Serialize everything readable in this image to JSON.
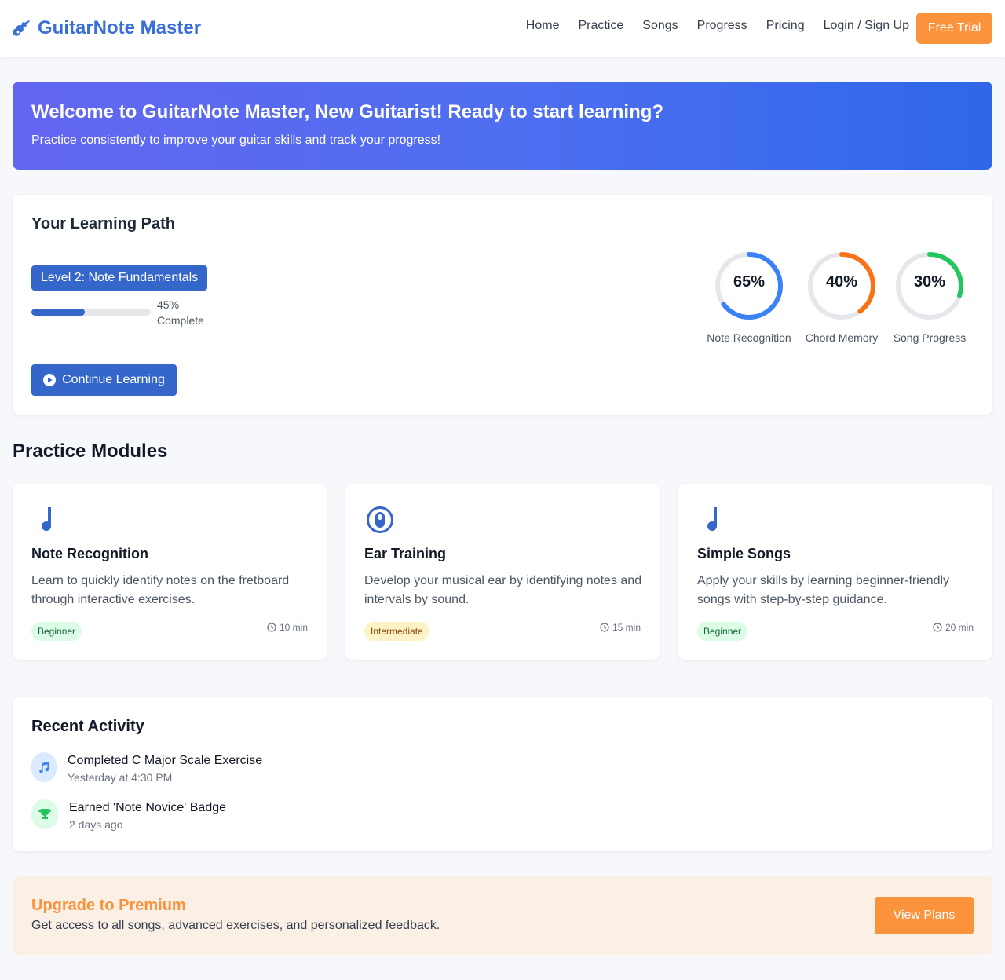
{
  "header": {
    "logo_text": "GuitarNote Master",
    "nav": [
      "Home",
      "Practice",
      "Songs",
      "Progress",
      "Pricing",
      "Login / Sign Up"
    ],
    "trial_label": "Free Trial"
  },
  "banner": {
    "title": "Welcome to GuitarNote Master, New Guitarist! Ready to start learning?",
    "subtitle": "Practice consistently to improve your guitar skills and track your progress!"
  },
  "path": {
    "title": "Your Learning Path",
    "level": "Level 2: Note Fundamentals",
    "progress": 45,
    "progress_label": "45% Complete",
    "continue_label": "Continue Learning",
    "rings": [
      {
        "value": 65,
        "label_value": "65%",
        "label": "Note Recognition",
        "color": "#3b82f6"
      },
      {
        "value": 40,
        "label_value": "40%",
        "label": "Chord Memory",
        "color": "#f97316"
      },
      {
        "value": 30,
        "label_value": "30%",
        "label": "Song Progress",
        "color": "#22c55e"
      }
    ]
  },
  "modules_title": "Practice Modules",
  "modules": [
    {
      "icon": "music-note-icon",
      "title": "Note Recognition",
      "desc": "Learn to quickly identify notes on the fretboard through interactive exercises.",
      "level": "Beginner",
      "duration": "10 min"
    },
    {
      "icon": "ear-icon",
      "title": "Ear Training",
      "desc": "Develop your musical ear by identifying notes and intervals by sound.",
      "level": "Intermediate",
      "duration": "15 min"
    },
    {
      "icon": "music-note-icon",
      "title": "Simple Songs",
      "desc": "Apply your skills by learning beginner-friendly songs with step-by-step guidance.",
      "level": "Beginner",
      "duration": "20 min"
    }
  ],
  "activity": {
    "title": "Recent Activity",
    "items": [
      {
        "icon": "music-icon",
        "title": "Completed C Major Scale Exercise",
        "time": "Yesterday at 4:30 PM"
      },
      {
        "icon": "trophy-icon",
        "title": "Earned 'Note Novice' Badge",
        "time": "2 days ago"
      }
    ]
  },
  "premium": {
    "title": "Upgrade to Premium",
    "text": "Get access to all songs, advanced exercises, and personalized feedback.",
    "button": "View Plans"
  }
}
